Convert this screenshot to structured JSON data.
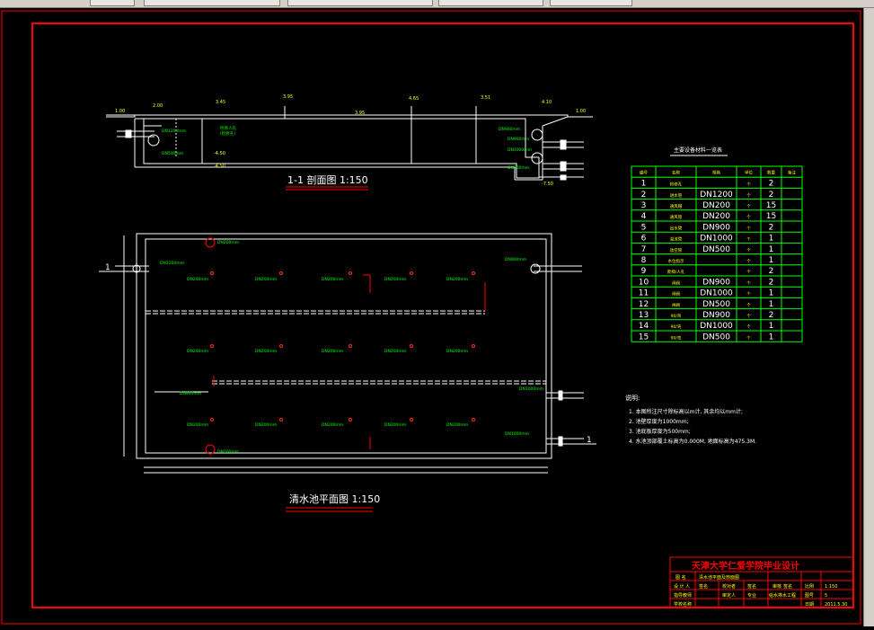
{
  "section_view": {
    "title": "1-1 剖面图 1:150",
    "elev_labels": [
      "1.00",
      "2.00",
      "3.45",
      "3.95",
      "4.65",
      "3.95",
      "3.51",
      "4.10",
      "1.00",
      "-4.50",
      "-4.50",
      "-7.50"
    ],
    "pipe_labels": [
      "DN1200mm",
      "DN900mm",
      "DN1000mm",
      "DN500mm",
      "DN500mm"
    ],
    "notes": [
      "检修人孔",
      "(检修孔)",
      "DN900mm"
    ]
  },
  "plan_view": {
    "title": "清水池平面图 1:150",
    "marker_left": "1",
    "marker_right": "1",
    "callouts": [
      "DN1200mm",
      "DN900mm",
      "DN1000mm",
      "DN200mm",
      "DN900mm",
      "DN1000mm",
      "DN200mm"
    ],
    "vent_label": "DN200mm",
    "row_labels": [
      [
        "DN200mm",
        "DN200mm",
        "DN200mm",
        "DN200mm",
        "DN200mm"
      ],
      [
        "DN200mm",
        "DN200mm",
        "DN200mm",
        "DN200mm",
        "DN200mm"
      ],
      [
        "DN200mm",
        "DN200mm",
        "DN200mm",
        "DN200mm",
        "DN200mm"
      ]
    ]
  },
  "equipment_table": {
    "title": "主要设备材料一览表",
    "headers": [
      "编号",
      "名称",
      "规格",
      "单位",
      "数量",
      "备注"
    ],
    "rows": [
      {
        "no": "1",
        "name": "检修孔",
        "spec": "",
        "unit": "个",
        "qty": "2",
        "note": ""
      },
      {
        "no": "2",
        "name": "进水管",
        "spec": "DN1200",
        "unit": "个",
        "qty": "2",
        "note": ""
      },
      {
        "no": "3",
        "name": "通风帽",
        "spec": "DN200",
        "unit": "个",
        "qty": "15",
        "note": ""
      },
      {
        "no": "4",
        "name": "通风管",
        "spec": "DN200",
        "unit": "个",
        "qty": "15",
        "note": ""
      },
      {
        "no": "5",
        "name": "出水管",
        "spec": "DN900",
        "unit": "个",
        "qty": "2",
        "note": ""
      },
      {
        "no": "6",
        "name": "溢流管",
        "spec": "DN1000",
        "unit": "个",
        "qty": "1",
        "note": ""
      },
      {
        "no": "7",
        "name": "放空管",
        "spec": "DN500",
        "unit": "个",
        "qty": "1",
        "note": ""
      },
      {
        "no": "8",
        "name": "水位指示",
        "spec": "",
        "unit": "个",
        "qty": "1",
        "note": ""
      },
      {
        "no": "9",
        "name": "爬梯/人孔",
        "spec": "",
        "unit": "个",
        "qty": "2",
        "note": ""
      },
      {
        "no": "10",
        "name": "闸阀",
        "spec": "DN900",
        "unit": "个",
        "qty": "2",
        "note": ""
      },
      {
        "no": "11",
        "name": "闸阀",
        "spec": "DN1000",
        "unit": "个",
        "qty": "1",
        "note": ""
      },
      {
        "no": "12",
        "name": "闸阀",
        "spec": "DN500",
        "unit": "个",
        "qty": "1",
        "note": ""
      },
      {
        "no": "13",
        "name": "90/弯",
        "spec": "DN900",
        "unit": "个",
        "qty": "2",
        "note": ""
      },
      {
        "no": "14",
        "name": "90/弯",
        "spec": "DN1000",
        "unit": "个",
        "qty": "1",
        "note": ""
      },
      {
        "no": "15",
        "name": "90/弯",
        "spec": "DN500",
        "unit": "个",
        "qty": "1",
        "note": ""
      }
    ]
  },
  "notes": {
    "heading": "说明:",
    "lines": [
      "1. 本图所注尺寸除标高以m计, 其余均以mm计;",
      "2. 池壁厚度为1000mm;",
      "3. 池底板厚度为500mm;",
      "4. 水池顶部覆土标高为0.000M, 地面标高为475.3M."
    ]
  },
  "title_block": {
    "school": "天津大学仁爱学院毕业设计",
    "row1": [
      "图  名",
      "清水池平面及剖面图",
      "",
      ""
    ],
    "row2": [
      "设 计 人",
      "签名",
      "校对者",
      "签名",
      "审核",
      "签名",
      "比例",
      "1:150"
    ],
    "row3": [
      "指导教师",
      "",
      "审定人",
      "",
      "专业",
      "给水排水工程",
      "图号",
      "5"
    ],
    "row4": [
      "学校名称",
      "",
      "",
      "",
      "日期",
      "2011.5.30"
    ]
  }
}
